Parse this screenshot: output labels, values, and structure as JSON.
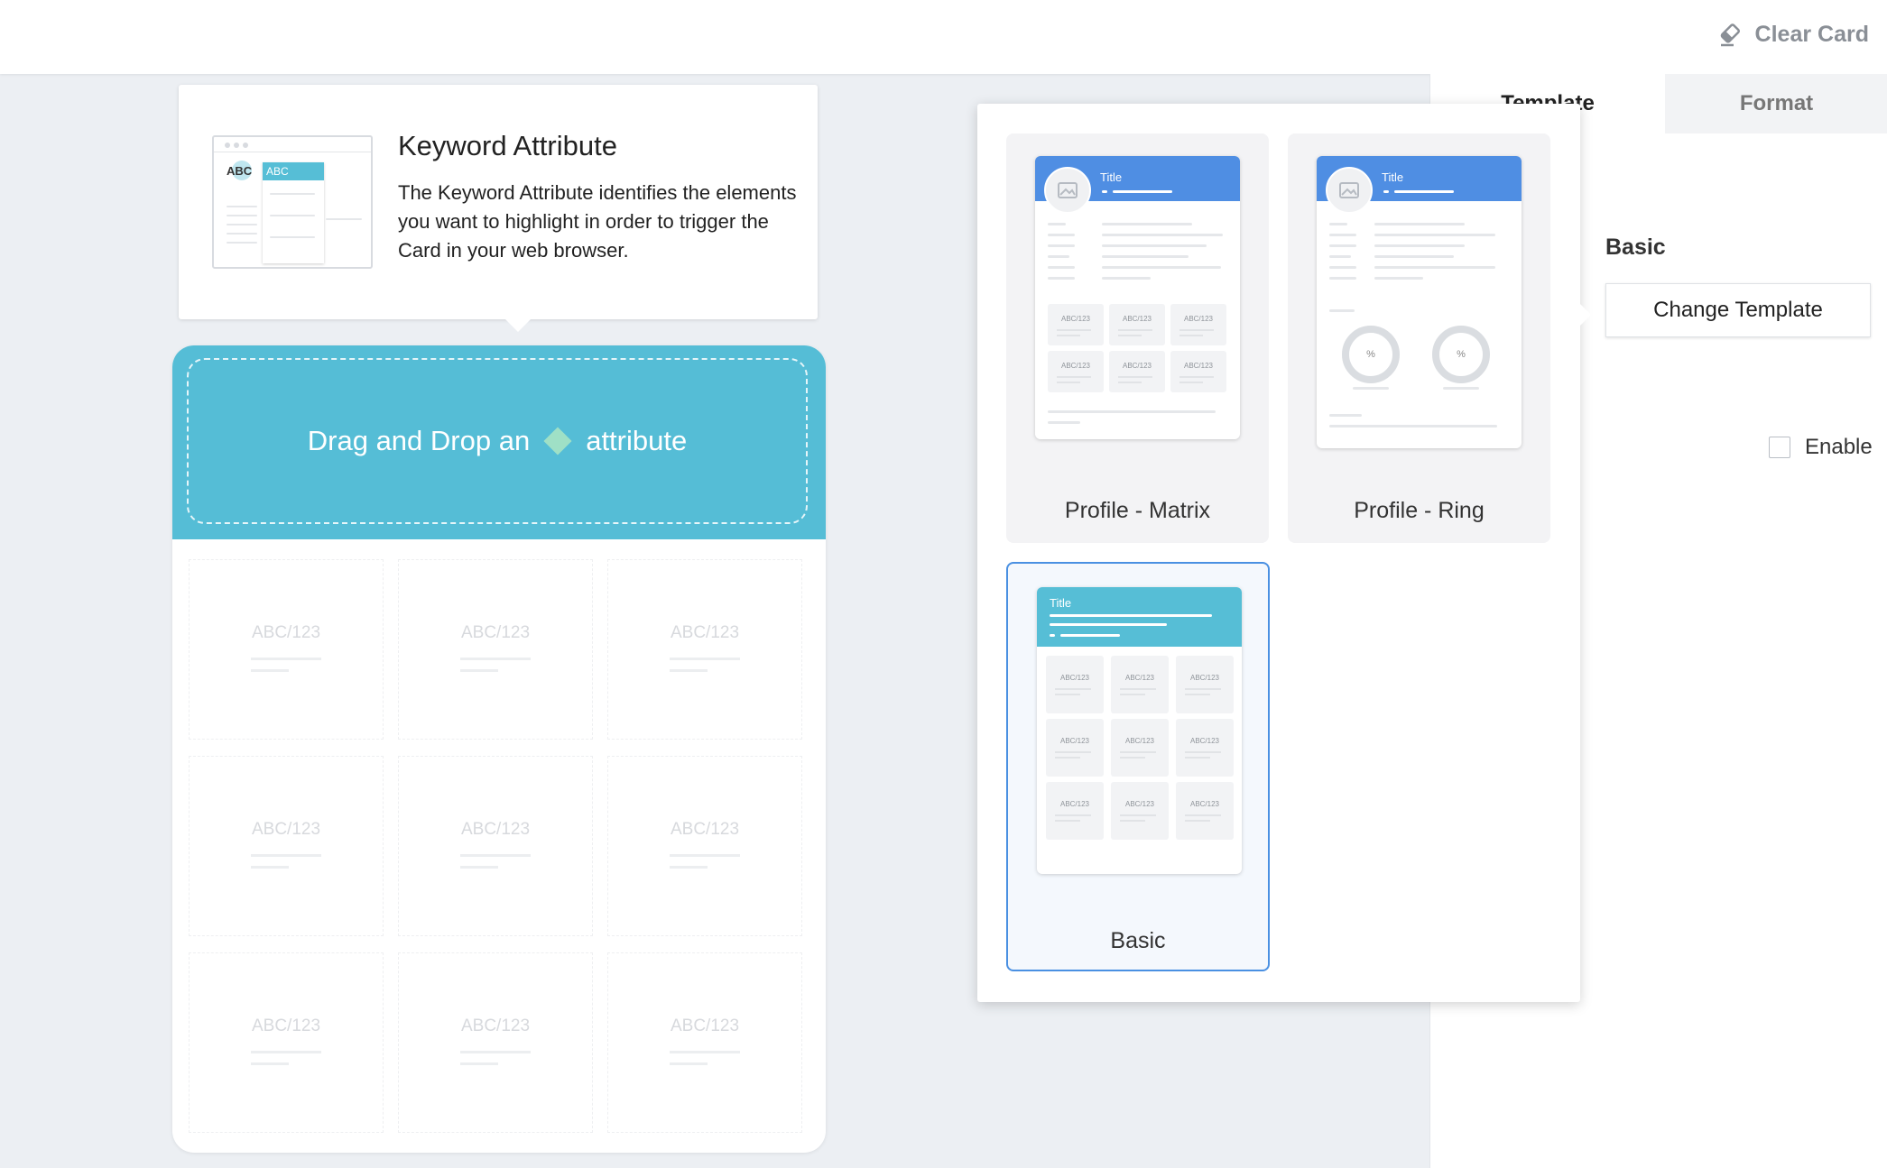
{
  "topbar": {
    "clear_card_label": "Clear Card",
    "clear_icon": "eraser-icon"
  },
  "sidebar": {
    "tabs": [
      {
        "label": "Template",
        "active": true
      },
      {
        "label": "Format",
        "active": false
      }
    ],
    "template_name": "Basic",
    "change_template_label": "Change Template",
    "enable_label": "Enable",
    "enable_checked": false
  },
  "templates": [
    {
      "name": "Profile - Matrix",
      "mini_title": "Title",
      "selected": false,
      "cells": [
        "ABC/123",
        "ABC/123",
        "ABC/123",
        "ABC/123",
        "ABC/123",
        "ABC/123"
      ]
    },
    {
      "name": "Profile - Ring",
      "mini_title": "Title",
      "selected": false,
      "rings": [
        "%",
        "%"
      ]
    },
    {
      "name": "Basic",
      "mini_title": "Title",
      "selected": true,
      "cells": [
        "ABC/123",
        "ABC/123",
        "ABC/123",
        "ABC/123",
        "ABC/123",
        "ABC/123",
        "ABC/123",
        "ABC/123",
        "ABC/123"
      ]
    }
  ],
  "info": {
    "title": "Keyword Attribute",
    "text": "The Keyword Attribute identifies the elements you want to highlight in order to trigger the Card in your web browser.",
    "illustration_text_1": "ABC",
    "illustration_text_2": "ABC"
  },
  "drop": {
    "text_before": "Drag and Drop an",
    "text_after": "attribute",
    "cells": [
      "ABC/123",
      "ABC/123",
      "ABC/123",
      "ABC/123",
      "ABC/123",
      "ABC/123",
      "ABC/123",
      "ABC/123",
      "ABC/123"
    ]
  },
  "colors": {
    "accent_blue": "#4f8ee3",
    "teal": "#55bdd6",
    "selected_border": "#4a90e2",
    "diamond": "#9fe0c6"
  }
}
